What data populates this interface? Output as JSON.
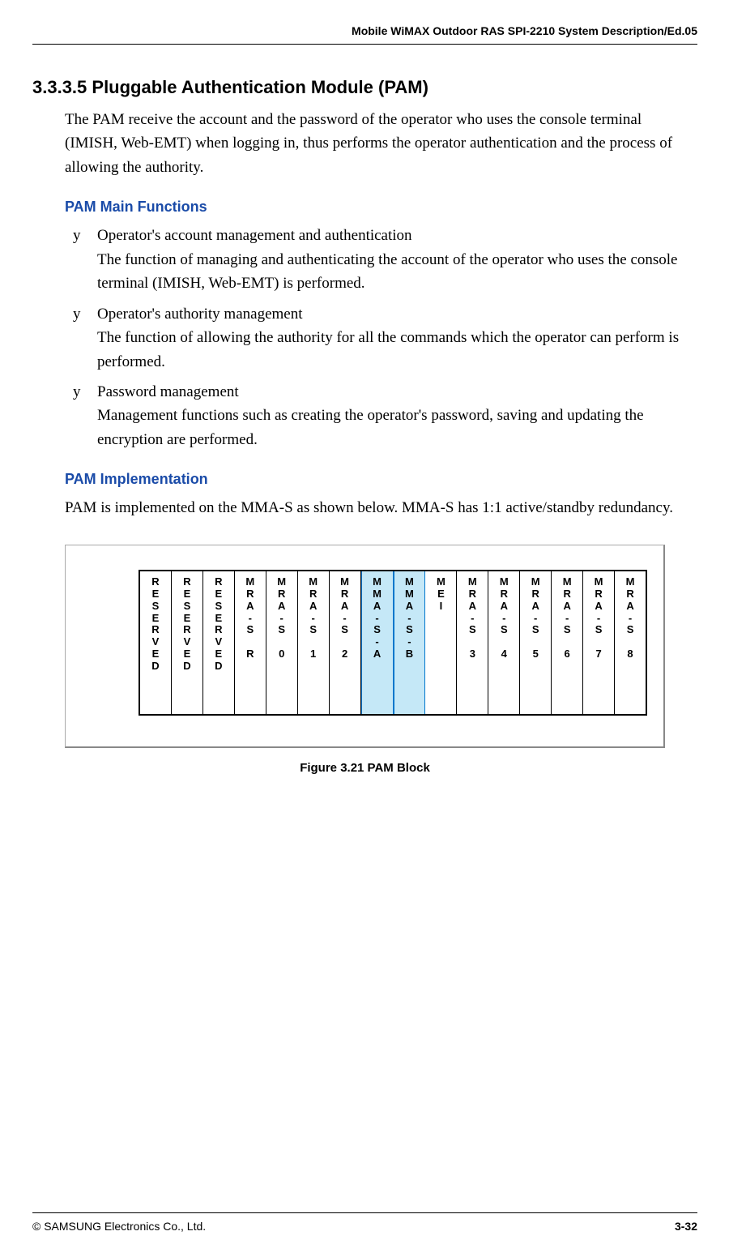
{
  "header": {
    "title": "Mobile WiMAX Outdoor RAS SPI-2210 System Description/Ed.05"
  },
  "section": {
    "number_title": "3.3.3.5  Pluggable Authentication Module (PAM)",
    "intro": "The PAM receive the account and the password of the operator who uses the console terminal (IMISH, Web-EMT) when logging in, thus performs the operator authentication and the process of allowing the authority."
  },
  "pam_main": {
    "heading": "PAM Main Functions",
    "bullets": [
      {
        "title": "Operator's account management and authentication",
        "desc": "The function of managing and authenticating the account of the operator who uses the console terminal (IMISH, Web-EMT) is performed."
      },
      {
        "title": "Operator's authority management",
        "desc": "The function of allowing the authority for all the commands which the operator can perform is performed."
      },
      {
        "title": "Password management",
        "desc": "Management functions such as creating the operator's password, saving and updating the encryption are performed."
      }
    ]
  },
  "pam_impl": {
    "heading": "PAM Implementation",
    "text": "PAM is implemented on the MMA-S as shown below. MMA-S has 1:1 active/standby redundancy."
  },
  "diagram": {
    "slots": [
      {
        "label": "RESERVED",
        "highlight": false
      },
      {
        "label": "RESERVED",
        "highlight": false
      },
      {
        "label": "RESERVED",
        "highlight": false
      },
      {
        "label": "MRA-S R",
        "highlight": false
      },
      {
        "label": "MRA-S 0",
        "highlight": false
      },
      {
        "label": "MRA-S 1",
        "highlight": false
      },
      {
        "label": "MRA-S 2",
        "highlight": false
      },
      {
        "label": "MMA-S-A",
        "highlight": true
      },
      {
        "label": "MMA-S-B",
        "highlight": true
      },
      {
        "label": "MEI",
        "highlight": false
      },
      {
        "label": "MRA-S 3",
        "highlight": false
      },
      {
        "label": "MRA-S 4",
        "highlight": false
      },
      {
        "label": "MRA-S 5",
        "highlight": false
      },
      {
        "label": "MRA-S 6",
        "highlight": false
      },
      {
        "label": "MRA-S 7",
        "highlight": false
      },
      {
        "label": "MRA-S 8",
        "highlight": false
      }
    ],
    "caption": "Figure 3.21    PAM Block"
  },
  "footer": {
    "copyright": "© SAMSUNG Electronics Co., Ltd.",
    "page": "3-32"
  }
}
